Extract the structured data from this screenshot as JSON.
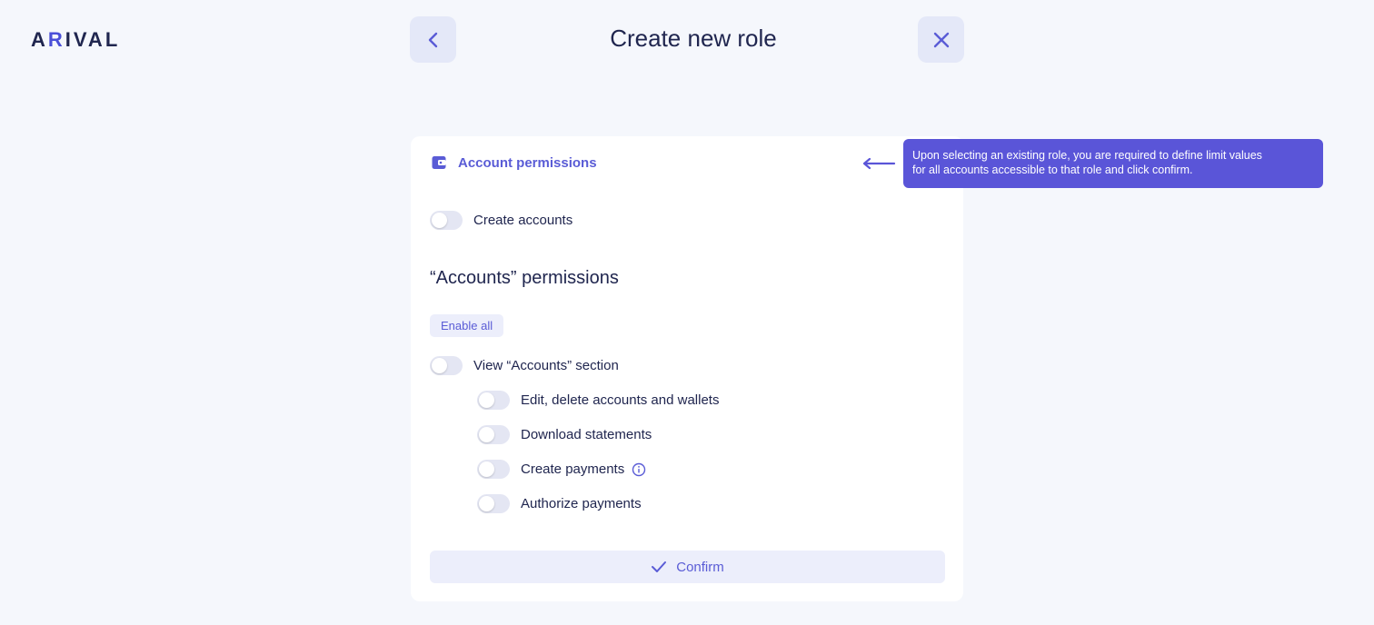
{
  "brand": {
    "logo_prefix": "A",
    "logo_accent": "R",
    "logo_suffix": "IVAL"
  },
  "header": {
    "title": "Create new role"
  },
  "card": {
    "section_header": "Account permissions",
    "create_accounts_label": "Create accounts",
    "section_title": "“Accounts” permissions",
    "enable_all_label": "Enable all",
    "view_accounts_label": "View “Accounts” section",
    "sub_permissions": [
      {
        "label": "Edit, delete accounts and wallets"
      },
      {
        "label": "Download statements"
      },
      {
        "label": "Create payments"
      },
      {
        "label": "Authorize payments"
      }
    ],
    "confirm_label": "Confirm"
  },
  "tooltip": {
    "line1": "Upon selecting an existing role, you are required to define limit values",
    "line2": "for all accounts accessible to that role and click confirm."
  },
  "colors": {
    "accent": "#5a5cd6",
    "tooltip_bg": "#5a55d8",
    "page_bg": "#f5f7fc",
    "card_bg": "#ffffff",
    "button_bg": "#e4e8f8"
  },
  "icons": {
    "back": "chevron-left-icon",
    "close": "close-icon",
    "section": "wallet-icon",
    "info": "info-icon",
    "confirm": "check-icon",
    "hint": "arrow-left-icon"
  }
}
